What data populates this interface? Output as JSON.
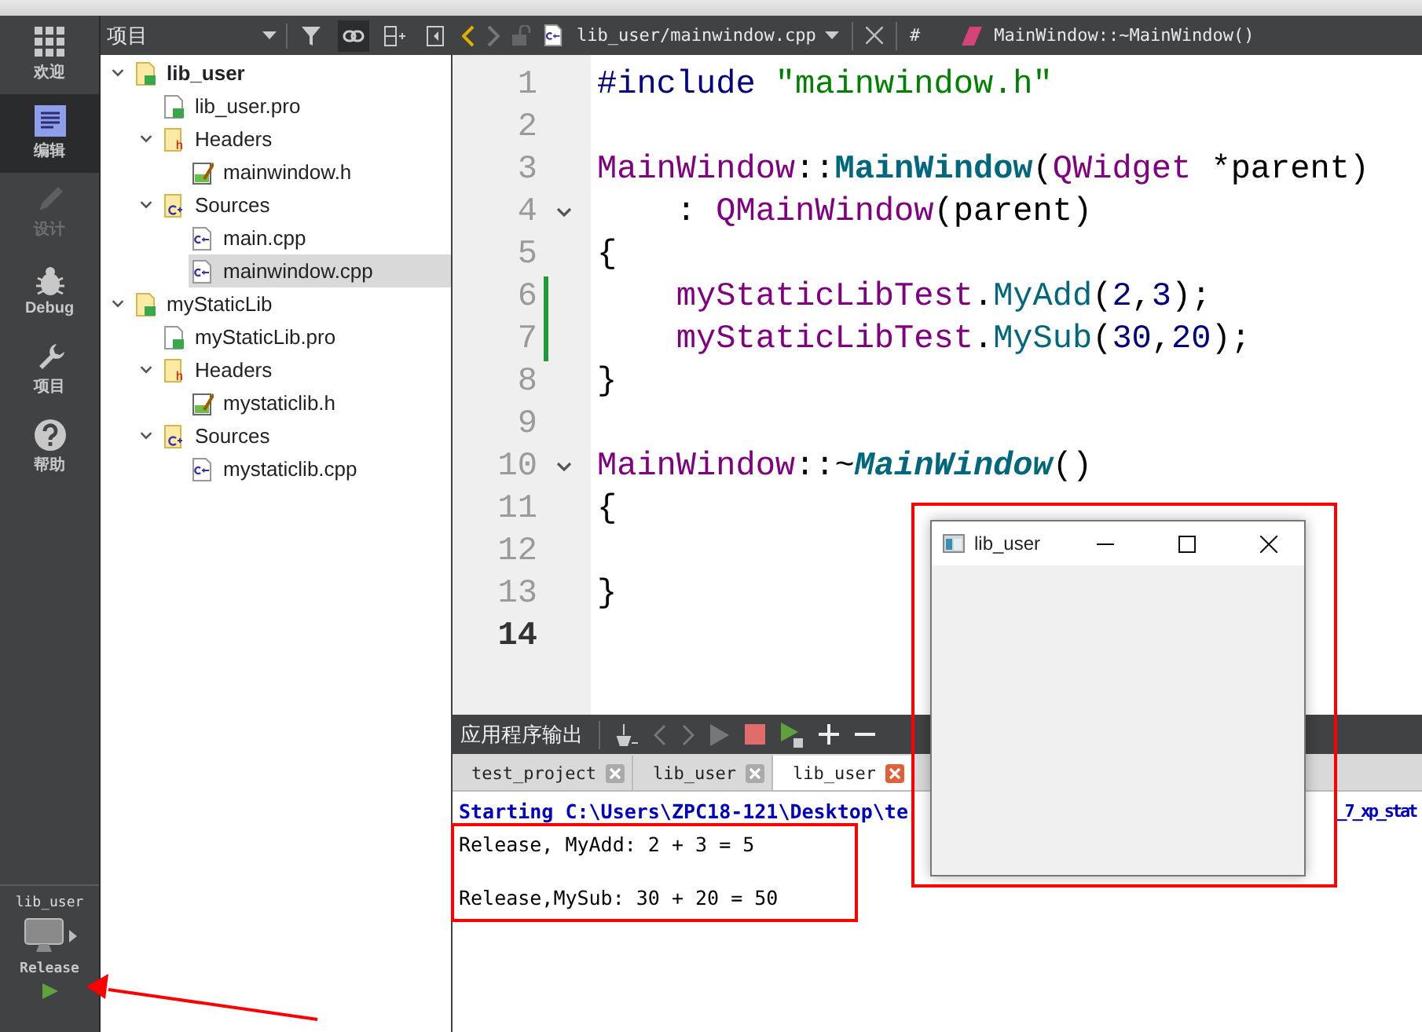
{
  "mode_bar": {
    "items": [
      {
        "kind": "welcome",
        "label": "欢迎",
        "selected": false,
        "disabled": false
      },
      {
        "kind": "edit",
        "label": "编辑",
        "selected": true,
        "disabled": false
      },
      {
        "kind": "design",
        "label": "设计",
        "selected": false,
        "disabled": true
      },
      {
        "kind": "debug",
        "label": "Debug",
        "selected": false,
        "disabled": false
      },
      {
        "kind": "projects",
        "label": "项目",
        "selected": false,
        "disabled": false
      },
      {
        "kind": "help",
        "label": "帮助",
        "selected": false,
        "disabled": false
      }
    ],
    "kit": {
      "project": "lib_user",
      "build": "Release"
    }
  },
  "project_panel": {
    "title": "项目",
    "tree": [
      {
        "kind": "project",
        "label": "lib_user",
        "active": true,
        "expanded": true,
        "selected": false,
        "children": [
          {
            "kind": "pro",
            "label": "lib_user.pro",
            "selected": false
          },
          {
            "kind": "headers",
            "label": "Headers",
            "expanded": true,
            "selected": false,
            "children": [
              {
                "kind": "h",
                "label": "mainwindow.h",
                "selected": false
              }
            ]
          },
          {
            "kind": "sources",
            "label": "Sources",
            "expanded": true,
            "selected": false,
            "children": [
              {
                "kind": "cpp",
                "label": "main.cpp",
                "selected": false
              },
              {
                "kind": "cpp",
                "label": "mainwindow.cpp",
                "selected": true
              }
            ]
          }
        ]
      },
      {
        "kind": "project",
        "label": "myStaticLib",
        "active": false,
        "expanded": true,
        "selected": false,
        "children": [
          {
            "kind": "pro",
            "label": "myStaticLib.pro",
            "selected": false
          },
          {
            "kind": "headers",
            "label": "Headers",
            "expanded": true,
            "selected": false,
            "children": [
              {
                "kind": "h",
                "label": "mystaticlib.h",
                "selected": false
              }
            ]
          },
          {
            "kind": "sources",
            "label": "Sources",
            "expanded": true,
            "selected": false,
            "children": [
              {
                "kind": "cpp",
                "label": "mystaticlib.cpp",
                "selected": false
              }
            ]
          }
        ]
      }
    ]
  },
  "editor": {
    "file_path": "lib_user/mainwindow.cpp",
    "hash": "#",
    "symbol": "MainWindow::~MainWindow()",
    "lines": [
      {
        "number": "1",
        "fold": false,
        "changed": false,
        "current": false,
        "tokens": [
          {
            "kind": "pre",
            "text": "#include"
          },
          {
            "kind": "str",
            "text": " \"mainwindow.h\""
          }
        ]
      },
      {
        "number": "2",
        "fold": false,
        "changed": false,
        "current": false
      },
      {
        "number": "3",
        "fold": false,
        "changed": false,
        "current": false,
        "tokens": [
          {
            "kind": "type",
            "text": "MainWindow"
          },
          {
            "kind": "plain",
            "text": "::"
          },
          {
            "kind": "decl",
            "text": "MainWindow"
          },
          {
            "kind": "plain",
            "text": "("
          },
          {
            "kind": "type",
            "text": "QWidget"
          },
          {
            "kind": "plain",
            "text": " *parent)"
          }
        ]
      },
      {
        "number": "4",
        "fold": true,
        "changed": false,
        "current": false,
        "tokens": [
          {
            "kind": "plain",
            "text": "    : "
          },
          {
            "kind": "type",
            "text": "QMainWindow"
          },
          {
            "kind": "plain",
            "text": "(parent)"
          }
        ]
      },
      {
        "number": "5",
        "fold": false,
        "changed": false,
        "current": false,
        "tokens": [
          {
            "kind": "plain",
            "text": "{"
          }
        ]
      },
      {
        "number": "6",
        "fold": false,
        "changed": true,
        "current": false,
        "tokens": [
          {
            "kind": "field",
            "text": "    myStaticLibTest"
          },
          {
            "kind": "plain",
            "text": "."
          },
          {
            "kind": "call",
            "text": "MyAdd"
          },
          {
            "kind": "plain",
            "text": "("
          },
          {
            "kind": "num",
            "text": "2"
          },
          {
            "kind": "plain",
            "text": ","
          },
          {
            "kind": "num",
            "text": "3"
          },
          {
            "kind": "plain",
            "text": ");"
          }
        ]
      },
      {
        "number": "7",
        "fold": false,
        "changed": true,
        "current": false,
        "tokens": [
          {
            "kind": "field",
            "text": "    myStaticLibTest"
          },
          {
            "kind": "plain",
            "text": "."
          },
          {
            "kind": "call",
            "text": "MySub"
          },
          {
            "kind": "plain",
            "text": "("
          },
          {
            "kind": "num",
            "text": "30"
          },
          {
            "kind": "plain",
            "text": ","
          },
          {
            "kind": "num",
            "text": "20"
          },
          {
            "kind": "plain",
            "text": ");"
          }
        ]
      },
      {
        "number": "8",
        "fold": false,
        "changed": false,
        "current": false,
        "tokens": [
          {
            "kind": "plain",
            "text": "}"
          }
        ]
      },
      {
        "number": "9",
        "fold": false,
        "changed": false,
        "current": false
      },
      {
        "number": "10",
        "fold": true,
        "changed": false,
        "current": false,
        "tokens": [
          {
            "kind": "type",
            "text": "MainWindow"
          },
          {
            "kind": "plain",
            "text": "::~"
          },
          {
            "kind": "virtual",
            "text": "MainWindow"
          },
          {
            "kind": "plain",
            "text": "()"
          }
        ]
      },
      {
        "number": "11",
        "fold": false,
        "changed": false,
        "current": false,
        "tokens": [
          {
            "kind": "plain",
            "text": "{"
          }
        ]
      },
      {
        "number": "12",
        "fold": false,
        "changed": false,
        "current": false
      },
      {
        "number": "13",
        "fold": false,
        "changed": false,
        "current": false,
        "tokens": [
          {
            "kind": "plain",
            "text": "}"
          }
        ]
      },
      {
        "number": "14",
        "fold": false,
        "changed": false,
        "current": true
      }
    ]
  },
  "output_pane": {
    "title": "应用程序输出",
    "tabs": [
      {
        "label": "test_project",
        "selected": false
      },
      {
        "label": "lib_user",
        "selected": false
      },
      {
        "label": "lib_user",
        "selected": true
      }
    ],
    "lines": [
      {
        "kind": "info",
        "parts": [
          "Starting C:\\Users\\ZPC18-121\\Desktop\\te",
          "_7_xp_stat"
        ]
      },
      {
        "kind": "plain",
        "parts": [
          "Release, MyAdd: 2 + 3 = 5"
        ]
      },
      {
        "kind": "plain",
        "parts": [
          "Release,MySub: 30 + 20 = 50"
        ]
      }
    ]
  },
  "app_window": {
    "title": "lib_user"
  }
}
